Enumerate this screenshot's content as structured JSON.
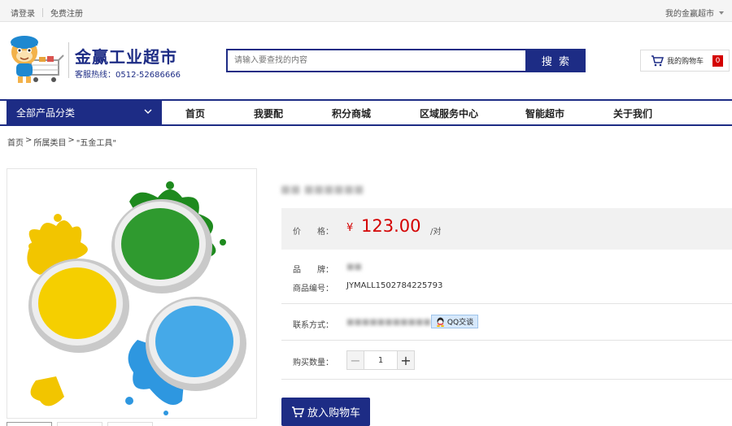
{
  "topbar": {
    "login": "请登录",
    "register": "免费注册",
    "my_account": "我的金赢超市"
  },
  "header": {
    "brand_name": "金赢工业超市",
    "hotline": "客服热线：0512-52686666",
    "search_placeholder": "请输入要查找的内容",
    "search_button": "搜 索",
    "cart_label": "我的购物车",
    "cart_count": "0"
  },
  "nav": {
    "all_categories": "全部产品分类",
    "items": [
      "首页",
      "我要配",
      "积分商城",
      "区域服务中心",
      "智能超市",
      "关于我们"
    ]
  },
  "breadcrumb": {
    "home": "首页",
    "sep": ">",
    "category": "所属类目",
    "current": "\"五金工具\""
  },
  "product": {
    "title": "■■ ■■■■■■",
    "price_label": "价　　格：",
    "currency": "¥",
    "price": "123.00",
    "unit": "/对",
    "brand_label": "品　　牌：",
    "brand_value": "■■",
    "sku_label": "商品编号：",
    "sku_value": "JYMALL1502784225793",
    "contact_label": "联系方式：",
    "contact_value": "■■■■■■■■■■■",
    "qq_label": "QQ交谈",
    "qty_label": "购买数量：",
    "qty_value": "1",
    "add_to_cart": "放入购物车"
  },
  "colors": {
    "brand_navy": "#1d2c85",
    "price_red": "#d40000",
    "price_panel_bg": "#f1f1f1"
  },
  "icons": [
    "cart-icon",
    "chevron-down-icon",
    "qq-icon",
    "minus-icon",
    "plus-icon",
    "mascot-logo"
  ]
}
